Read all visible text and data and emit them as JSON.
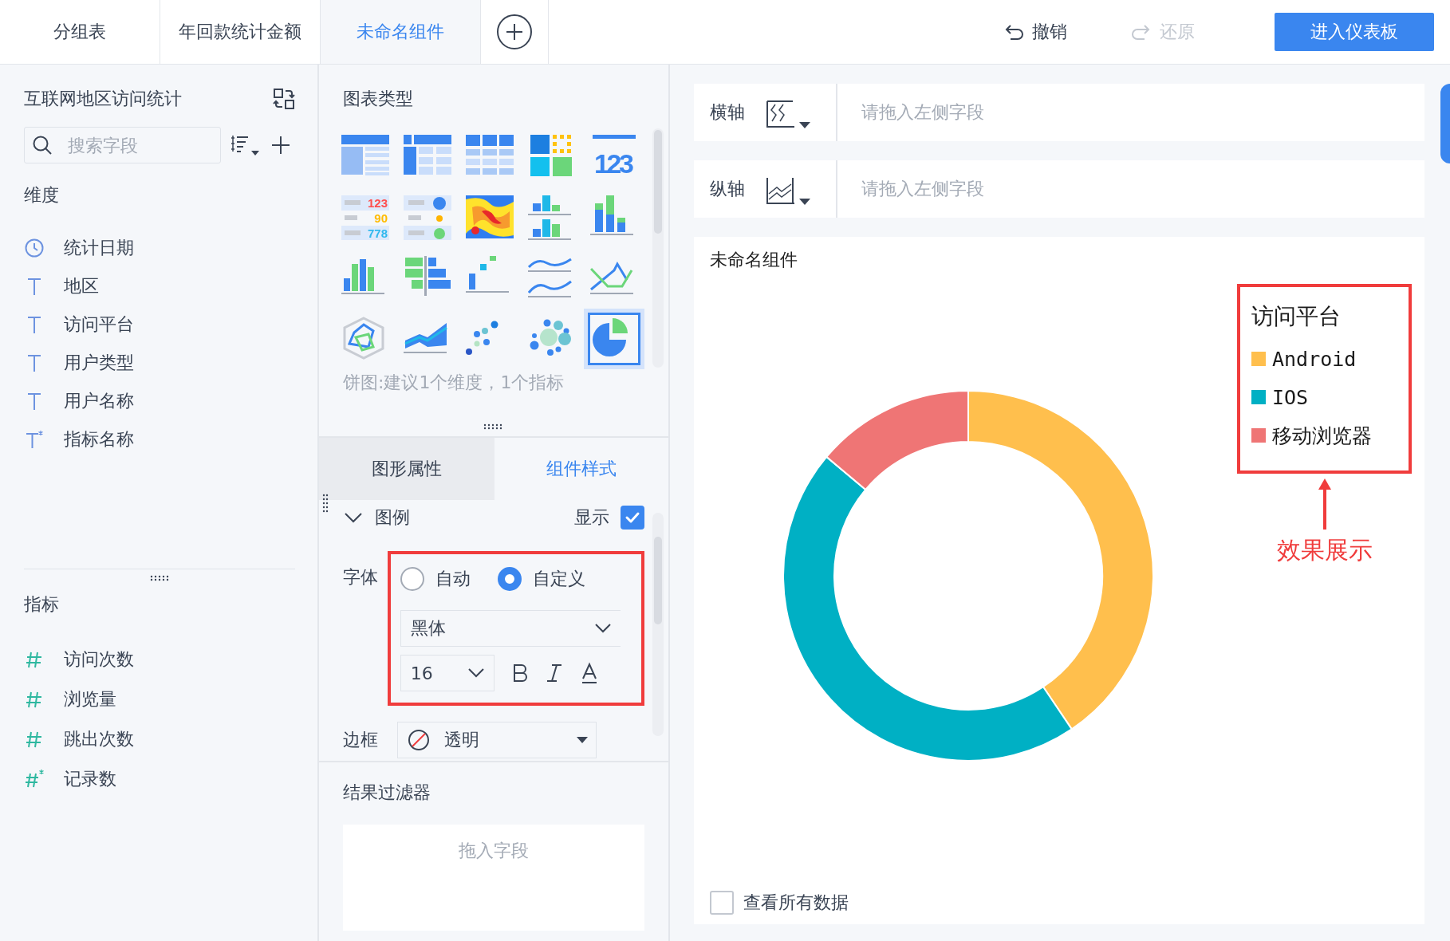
{
  "tabs": [
    {
      "label": "分组表",
      "selected": false
    },
    {
      "label": "年回款统计金额",
      "selected": false
    },
    {
      "label": "未命名组件",
      "selected": true
    }
  ],
  "actions": [
    {
      "label": "撤销",
      "kind": "undo",
      "disabled": false
    },
    {
      "label": "还原",
      "kind": "redo",
      "disabled": true
    }
  ],
  "primary_button": "进入仪表板",
  "data_panel": {
    "title": "互联网地区访问统计",
    "search": {
      "placeholder": "搜索字段"
    },
    "dimensions": {
      "heading": "维度",
      "items": [
        {
          "label": "统计日期",
          "kind": "date"
        },
        {
          "label": "地区",
          "kind": "text"
        },
        {
          "label": "访问平台",
          "kind": "text"
        },
        {
          "label": "用户类型",
          "kind": "text"
        },
        {
          "label": "用户名称",
          "kind": "text"
        },
        {
          "label": "指标名称",
          "kind": "text-calc"
        }
      ]
    },
    "measures": {
      "heading": "指标",
      "items": [
        {
          "label": "访问次数",
          "kind": "number"
        },
        {
          "label": "浏览量",
          "kind": "number"
        },
        {
          "label": "跳出次数",
          "kind": "number"
        },
        {
          "label": "记录数",
          "kind": "number-calc"
        }
      ]
    }
  },
  "chart_types": {
    "heading": "图表类型",
    "hint": "饼图:建议1个维度，1个指标",
    "items": [
      {
        "kind": "group-table",
        "selected": false
      },
      {
        "kind": "cross-table",
        "selected": false
      },
      {
        "kind": "detail-table",
        "selected": false
      },
      {
        "kind": "color-table",
        "selected": false
      },
      {
        "kind": "kpi",
        "selected": false,
        "glyphs": [
          "123"
        ]
      },
      {
        "kind": "text-kpi",
        "selected": false,
        "glyphs": [
          "123",
          "90",
          "778"
        ]
      },
      {
        "kind": "dot-kpi",
        "selected": false
      },
      {
        "kind": "heatmap",
        "selected": false
      },
      {
        "kind": "grouped-bar",
        "selected": false
      },
      {
        "kind": "stacked-bar",
        "selected": false
      },
      {
        "kind": "column",
        "selected": false
      },
      {
        "kind": "diverging-bar",
        "selected": false
      },
      {
        "kind": "range-column",
        "selected": false
      },
      {
        "kind": "multi-line",
        "selected": false
      },
      {
        "kind": "combo-line",
        "selected": false
      },
      {
        "kind": "radar",
        "selected": false
      },
      {
        "kind": "area",
        "selected": false
      },
      {
        "kind": "scatter",
        "selected": false
      },
      {
        "kind": "bubble",
        "selected": false
      },
      {
        "kind": "pie",
        "selected": true
      }
    ]
  },
  "style_tabs": [
    {
      "label": "图形属性",
      "selected": false
    },
    {
      "label": "组件样式",
      "selected": true
    }
  ],
  "legend_section": {
    "title": "图例",
    "expanded": true,
    "show": {
      "label": "显示",
      "checked": true
    },
    "font": {
      "label": "字体",
      "options": [
        {
          "label": "自动",
          "selected": false
        },
        {
          "label": "自定义",
          "selected": true
        }
      ],
      "family": "黑体",
      "size": "16"
    },
    "border": {
      "label": "边框",
      "value": "透明"
    }
  },
  "result_filter": {
    "heading": "结果过滤器",
    "drop_hint": "拖入字段"
  },
  "axes": [
    {
      "label": "横轴",
      "kind": "x",
      "placeholder": "请拖入左侧字段"
    },
    {
      "label": "纵轴",
      "kind": "y",
      "placeholder": "请拖入左侧字段"
    }
  ],
  "chart": {
    "title": "未命名组件",
    "legend": {
      "title": "访问平台",
      "items": [
        {
          "label": "Android",
          "color": "#ffbf4d"
        },
        {
          "label": "IOS",
          "color": "#00b0c4"
        },
        {
          "label": "移动浏览器",
          "color": "#ef7575"
        }
      ]
    },
    "annotation": "效果展示",
    "show_all": {
      "label": "查看所有数据",
      "checked": false
    }
  }
}
